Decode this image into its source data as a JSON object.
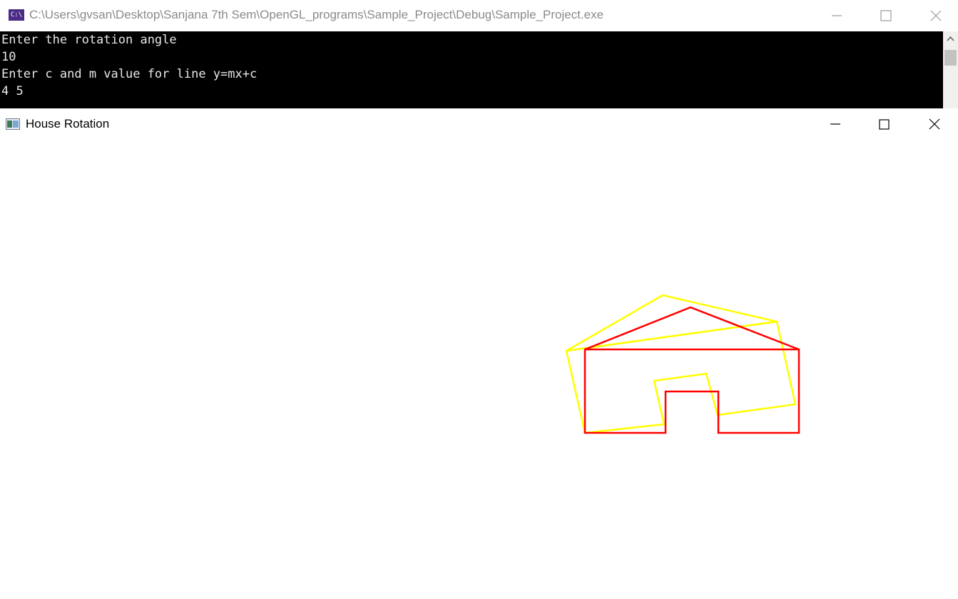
{
  "console": {
    "title": "C:\\Users\\gvsan\\Desktop\\Sanjana 7th Sem\\OpenGL_programs\\Sample_Project\\Debug\\Sample_Project.exe",
    "icon_text": "C:\\",
    "lines": [
      "Enter the rotation angle",
      "10",
      "Enter c and m value for line y=mx+c",
      "4 5"
    ]
  },
  "gl_window": {
    "title": "House Rotation",
    "colors": {
      "original_house": "#ff0000",
      "rotated_house": "#ffff00",
      "background": "#ffffff"
    }
  }
}
